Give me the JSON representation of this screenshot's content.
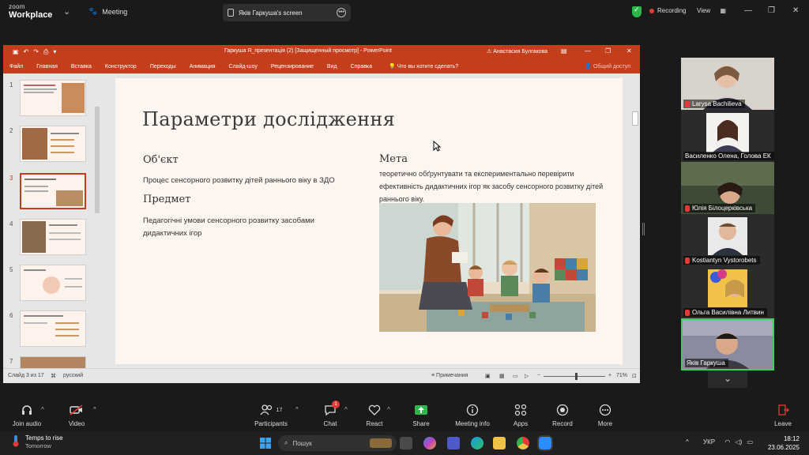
{
  "zoom": {
    "logo_line1": "zoom",
    "logo_line2": "Workplace",
    "meeting_label": "Meeting",
    "share_title": "Яків Гаркуша's screen",
    "recording_label": "Recording",
    "view_label": "View",
    "toolbar": {
      "join_audio": "Join audio",
      "video": "Video",
      "participants": "Participants",
      "participants_count": "17",
      "chat": "Chat",
      "chat_badge": "1",
      "react": "React",
      "share": "Share",
      "meeting_info": "Meeting info",
      "apps": "Apps",
      "record": "Record",
      "more": "More",
      "leave": "Leave"
    },
    "participants": [
      {
        "name": "Larysa Bachilieva",
        "muted": true
      },
      {
        "name": "Василенко Олена, Голова ЕК",
        "muted": false
      },
      {
        "name": "Юлія Білоцерківська",
        "muted": true
      },
      {
        "name": "Kostiantyn Vystorobets",
        "muted": true
      },
      {
        "name": "Ольга Василівна Литвин",
        "muted": true
      },
      {
        "name": "Яків Гаркуша",
        "muted": false,
        "active": true
      }
    ]
  },
  "ppt": {
    "doc_title": "Гаркуша Я_презентація (2) [Защищенный просмотр] - PowerPoint",
    "user": "Анастасия Булгакова",
    "menu": [
      "Файл",
      "Главная",
      "Вставка",
      "Конструктор",
      "Переходы",
      "Анимация",
      "Слайд-шоу",
      "Рецензирование",
      "Вид",
      "Справка"
    ],
    "tell_me": "Что вы хотите сделать?",
    "share": "Общий доступ",
    "thumb_numbers": [
      "1",
      "2",
      "3",
      "4",
      "5",
      "6",
      "7"
    ],
    "active_slide": 3,
    "status": {
      "slide_info": "Слайд 3 из 17",
      "language": "русский",
      "notes": "Примечания",
      "zoom": "71%"
    },
    "slide": {
      "title": "Параметри дослідження",
      "object_heading": "Об'єкт",
      "object_text": "Процес сенсорного розвитку дітей раннього віку в ЗДО",
      "subject_heading": "Предмет",
      "subject_text": "Педагогічні умови сенсорного розвитку засобами дидактичних ігор",
      "goal_heading": "Мета",
      "goal_text": "теоретично обґрунтувати та експериментально перевірити ефективність дидактичних ігор як засобу сенсорного розвитку дітей раннього віку."
    }
  },
  "taskbar": {
    "weather_line1": "Temps to rise",
    "weather_line2": "Tomorrow",
    "search_placeholder": "Пошук",
    "language": "УКР",
    "time": "18:12",
    "date": "23.06.2025"
  }
}
